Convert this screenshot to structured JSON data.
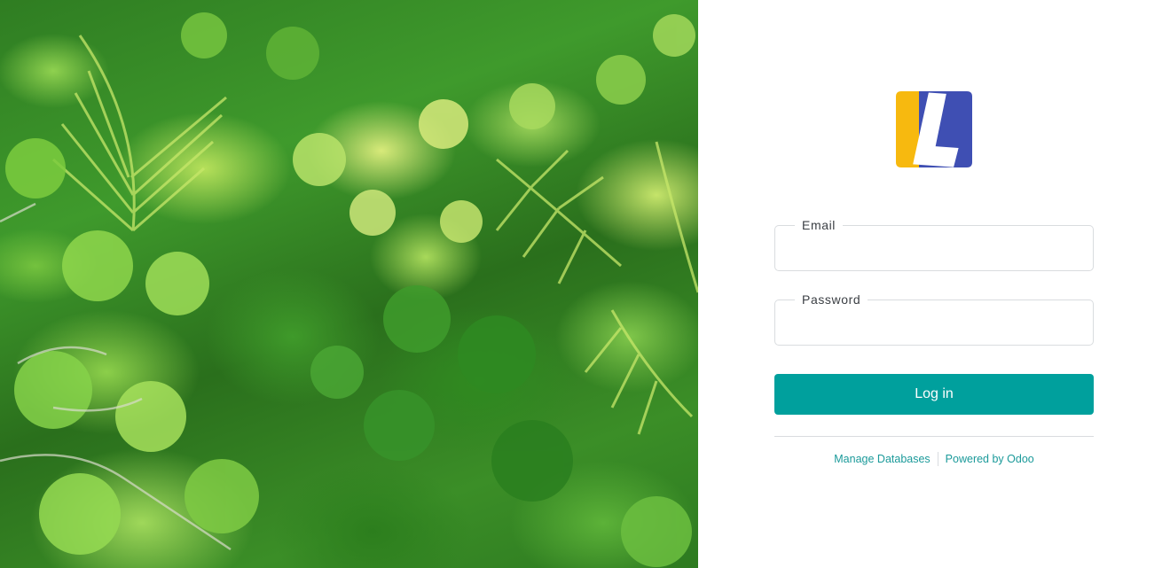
{
  "background": {
    "image_name": "rainforest-canopy-photo"
  },
  "brand": {
    "logo_icon": "letter-l-logo-icon",
    "colors": {
      "logo_yellow": "#f7b90f",
      "logo_blue": "#3f4fb3",
      "accent": "#00a09d",
      "link": "#1b9a9a"
    }
  },
  "form": {
    "email_label": "Email",
    "email_value": "",
    "password_label": "Password",
    "password_value": "",
    "login_label": "Log in"
  },
  "footer": {
    "manage_databases": "Manage Databases",
    "powered_by": "Powered by Odoo"
  }
}
